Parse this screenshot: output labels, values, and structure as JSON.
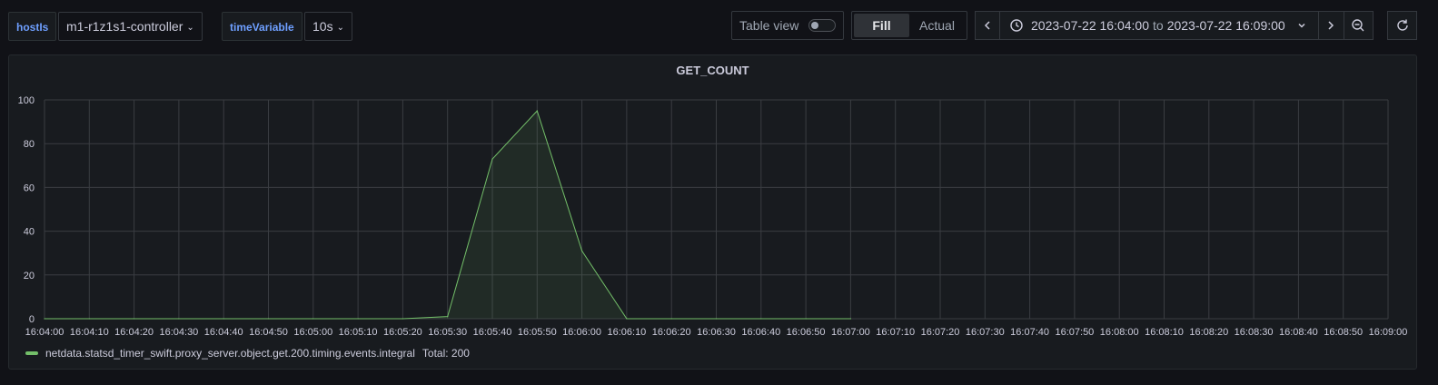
{
  "variables": {
    "host": {
      "label": "hostIs",
      "value": "m1-r1z1s1-controller"
    },
    "time": {
      "label": "timeVariable",
      "value": "10s"
    }
  },
  "toolbar": {
    "table_view_label": "Table view",
    "table_view_on": false,
    "fill_label": "Fill",
    "actual_label": "Actual",
    "range_from": "2023-07-22 16:04:00",
    "range_to_word": "to",
    "range_to": "2023-07-22 16:09:00",
    "icons": {
      "prev": "chevron-left-icon",
      "clock": "clock-icon",
      "caret": "chevron-down-icon",
      "next": "chevron-right-icon",
      "zoom": "zoom-out-icon",
      "refresh": "refresh-icon"
    }
  },
  "panel": {
    "title": "GET_COUNT"
  },
  "legend": {
    "series_name": "netdata.statsd_timer_swift.proxy_server.object.get.200.timing.events.integral",
    "total": "Total: 200"
  },
  "colors": {
    "series": "#73bf69",
    "accent_label": "#6e9fff",
    "grid": "#3a3d42"
  },
  "chart_data": {
    "type": "area",
    "title": "GET_COUNT",
    "xlabel": "",
    "ylabel": "",
    "ylim": [
      0,
      100
    ],
    "yticks": [
      0,
      20,
      40,
      60,
      80,
      100
    ],
    "xticks": [
      "16:04:00",
      "16:04:10",
      "16:04:20",
      "16:04:30",
      "16:04:40",
      "16:04:50",
      "16:05:00",
      "16:05:10",
      "16:05:20",
      "16:05:30",
      "16:05:40",
      "16:05:50",
      "16:06:00",
      "16:06:10",
      "16:06:20",
      "16:06:30",
      "16:06:40",
      "16:06:50",
      "16:07:00",
      "16:07:10",
      "16:07:20",
      "16:07:30",
      "16:07:40",
      "16:07:50",
      "16:08:00",
      "16:08:10",
      "16:08:20",
      "16:08:30",
      "16:08:40",
      "16:08:50",
      "16:09:00"
    ],
    "grid": true,
    "legend_position": "bottom-left",
    "series": [
      {
        "name": "netdata.statsd_timer_swift.proxy_server.object.get.200.timing.events.integral",
        "x": [
          "16:04:00",
          "16:04:10",
          "16:04:20",
          "16:04:30",
          "16:04:40",
          "16:04:50",
          "16:05:00",
          "16:05:10",
          "16:05:20",
          "16:05:30",
          "16:05:40",
          "16:05:50",
          "16:06:00",
          "16:06:10",
          "16:06:20",
          "16:06:30",
          "16:06:40",
          "16:06:50",
          "16:07:00"
        ],
        "values": [
          0,
          0,
          0,
          0,
          0,
          0,
          0,
          0,
          0,
          1,
          73,
          95,
          31,
          0,
          0,
          0,
          0,
          0,
          0
        ]
      }
    ]
  }
}
